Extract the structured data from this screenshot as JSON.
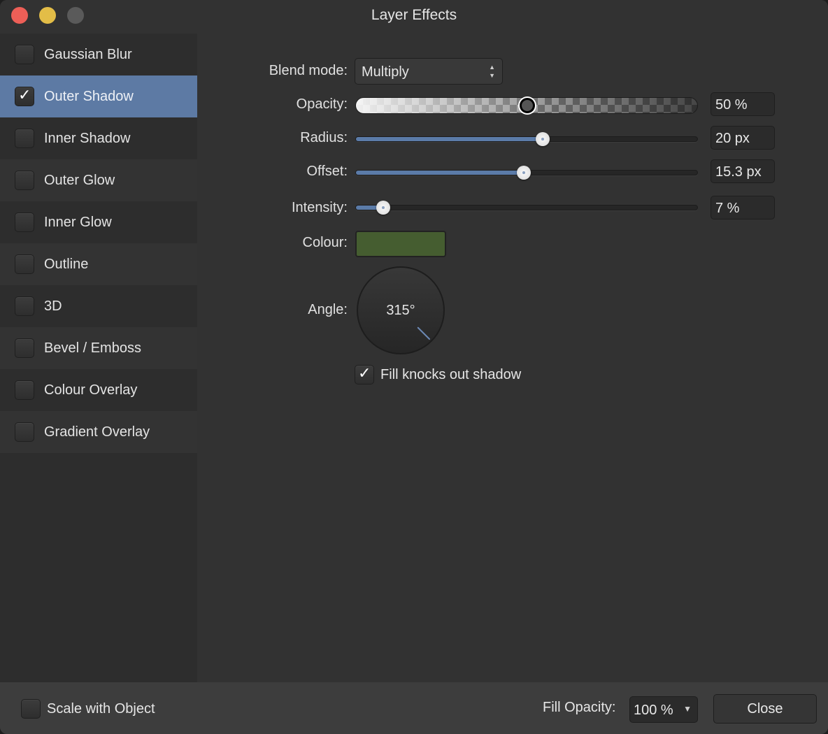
{
  "window": {
    "title": "Layer Effects",
    "traffic_lights": [
      "close",
      "minimize",
      "zoom"
    ]
  },
  "sidebar": {
    "items": [
      {
        "label": "Gaussian Blur",
        "checked": false,
        "selected": false
      },
      {
        "label": "Outer Shadow",
        "checked": true,
        "selected": true
      },
      {
        "label": "Inner Shadow",
        "checked": false,
        "selected": false
      },
      {
        "label": "Outer Glow",
        "checked": false,
        "selected": false
      },
      {
        "label": "Inner Glow",
        "checked": false,
        "selected": false
      },
      {
        "label": "Outline",
        "checked": false,
        "selected": false
      },
      {
        "label": "3D",
        "checked": false,
        "selected": false
      },
      {
        "label": "Bevel / Emboss",
        "checked": false,
        "selected": false
      },
      {
        "label": "Colour Overlay",
        "checked": false,
        "selected": false
      },
      {
        "label": "Gradient Overlay",
        "checked": false,
        "selected": false
      }
    ],
    "check_glyph": "✓"
  },
  "settings": {
    "blend_mode": {
      "label": "Blend mode:",
      "value": "Multiply"
    },
    "opacity": {
      "label": "Opacity:",
      "value": "50 %",
      "fraction": 0.5
    },
    "radius": {
      "label": "Radius:",
      "value": "20 px",
      "fraction": 0.544
    },
    "offset": {
      "label": "Offset:",
      "value": "15.3 px",
      "fraction": 0.49
    },
    "intensity": {
      "label": "Intensity:",
      "value": "7 %",
      "fraction": 0.08
    },
    "colour": {
      "label": "Colour:",
      "value": "#455d30"
    },
    "angle": {
      "label": "Angle:",
      "value": "315°",
      "degrees": 315
    },
    "fill_knocks_out": {
      "label": "Fill knocks out shadow",
      "checked": true
    }
  },
  "footer": {
    "scale_with_object": {
      "label": "Scale with Object",
      "checked": false
    },
    "fill_opacity": {
      "label": "Fill Opacity:",
      "value": "100 %"
    },
    "close_label": "Close",
    "dropdown_glyph": "▼"
  },
  "colors": {
    "accent": "#5d7aa4",
    "slider_fill": "#5b7ba8"
  }
}
